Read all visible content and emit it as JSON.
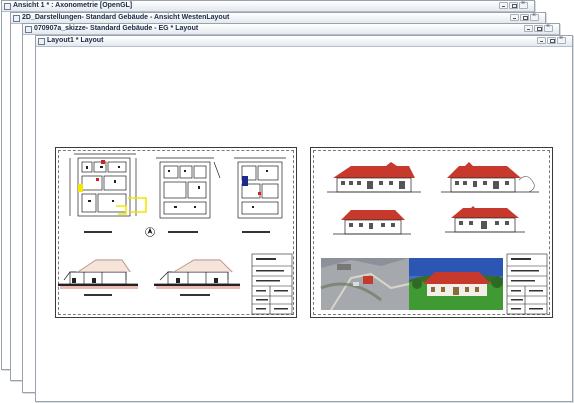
{
  "windows": [
    {
      "title": "Ansicht 1 * : Axonometrie [OpenGL]"
    },
    {
      "title": "2D_Darstellungen- Standard Gebäude - Ansicht WestenLayout"
    },
    {
      "title": "070907a_skizze- Standard Gebäude - EG * Layout"
    },
    {
      "title": "Layout1 * Layout"
    }
  ],
  "window_controls": {
    "minimize": "minimize-icon",
    "maximize": "maximize-icon",
    "close": "close-icon"
  },
  "layout": {
    "sheets": [
      {
        "name": "floor-plans-and-sections-sheet",
        "content": "grundrisse-schnitte"
      },
      {
        "name": "elevations-and-photos-sheet",
        "content": "ansichten-fotos"
      }
    ]
  },
  "colors": {
    "title_text": "#1a2a44",
    "roof_red": "#c6392c",
    "plan_yellow": "#f2e600",
    "plan_red": "#d0202a",
    "plan_blue": "#1c2a8a"
  }
}
